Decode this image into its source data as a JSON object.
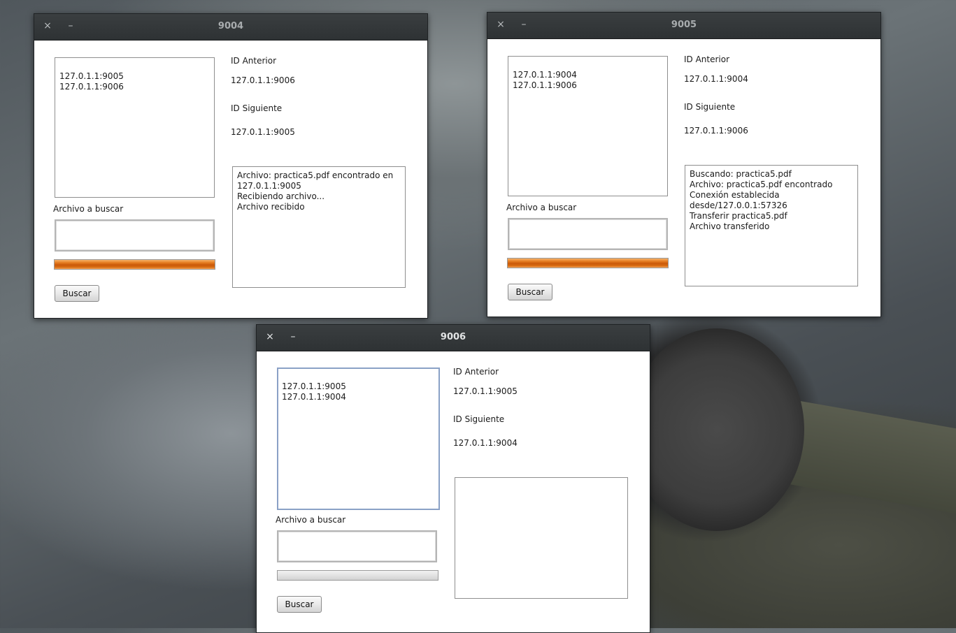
{
  "desktop": {
    "wallpaper": "watch-photo"
  },
  "windows": {
    "w9004": {
      "title": "9004",
      "close_icon": "×",
      "minimize_icon": "–",
      "peers": [
        "127.0.1.1:9005",
        "127.0.1.1:9006"
      ],
      "prev_label": "ID Anterior",
      "prev_value": "127.0.1.1:9006",
      "next_label": "ID Siguiente",
      "next_value": "127.0.1.1:9005",
      "file_label": "Archivo a buscar",
      "file_value": "",
      "progress": 100,
      "search_button": "Buscar",
      "log": [
        "Archivo: practica5.pdf encontrado en",
        "127.0.1.1:9005",
        "Recibiendo archivo...",
        "Archivo recibido"
      ]
    },
    "w9005": {
      "title": "9005",
      "close_icon": "×",
      "minimize_icon": "–",
      "peers": [
        "127.0.1.1:9004",
        "127.0.1.1:9006"
      ],
      "prev_label": "ID Anterior",
      "prev_value": "127.0.1.1:9004",
      "next_label": "ID Siguiente",
      "next_value": "127.0.1.1:9006",
      "file_label": "Archivo a buscar",
      "file_value": "",
      "progress": 100,
      "search_button": "Buscar",
      "log": [
        "Buscando: practica5.pdf",
        "Archivo: practica5.pdf encontrado",
        "Conexión establecida",
        "desde/127.0.0.1:57326",
        "Transferir practica5.pdf",
        "Archivo transferido"
      ]
    },
    "w9006": {
      "title": "9006",
      "close_icon": "×",
      "minimize_icon": "–",
      "peers": [
        "127.0.1.1:9005",
        "127.0.1.1:9004"
      ],
      "prev_label": "ID Anterior",
      "prev_value": "127.0.1.1:9005",
      "next_label": "ID Siguiente",
      "next_value": "127.0.1.1:9004",
      "file_label": "Archivo a buscar",
      "file_value": "",
      "progress": 0,
      "search_button": "Buscar",
      "log": []
    }
  },
  "colors": {
    "progress_fill": "#e67e22",
    "titlebar": "#2e3234",
    "focus_border": "#8aa1c6"
  }
}
